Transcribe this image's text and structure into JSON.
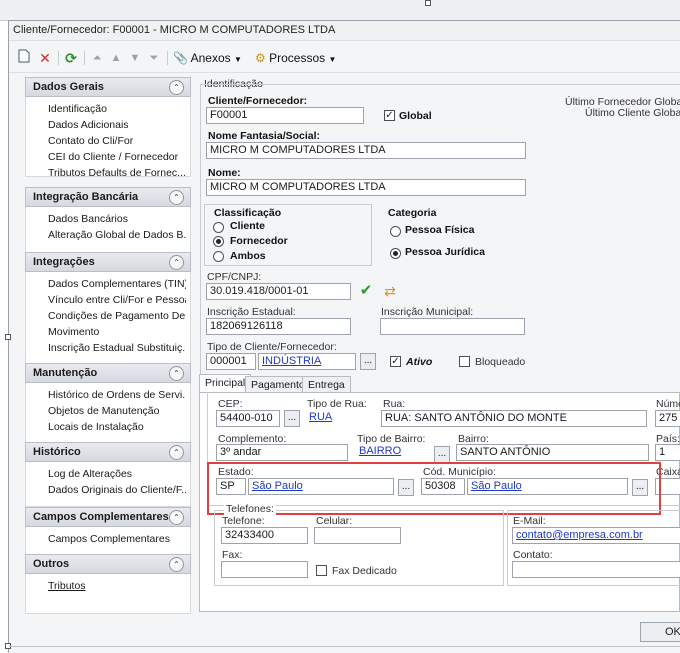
{
  "window": {
    "title": "Cliente/Fornecedor: F00001 - MICRO M COMPUTADORES LTDA",
    "ok_label": "OK"
  },
  "toolbar": {
    "anexos_label": "Anexos",
    "processos_label": "Processos"
  },
  "sidebar": {
    "sections": [
      {
        "title": "Dados Gerais",
        "items": [
          "Identificação",
          "Dados Adicionais",
          "Contato do Cli/For",
          "CEI do Cliente / Fornecedor",
          "Tributos Defaults de Fornec..."
        ]
      },
      {
        "title": "Integração Bancária",
        "items": [
          "Dados Bancários",
          "Alteração Global de Dados B..."
        ]
      },
      {
        "title": "Integrações",
        "items": [
          "Dados Complementares (TIN)",
          "Vínculo entre Cli/For e Pessoa",
          "Condições de Pagamento De...",
          "Movimento",
          "Inscrição Estadual Substituiç..."
        ]
      },
      {
        "title": "Manutenção",
        "items": [
          "Histórico de Ordens de Servi...",
          "Objetos de Manutenção",
          "Locais de Instalação"
        ]
      },
      {
        "title": "Histórico",
        "items": [
          "Log de Alterações",
          "Dados Originais do Cliente/F..."
        ]
      },
      {
        "title": "Campos Complementares",
        "items": [
          "Campos Complementares"
        ]
      },
      {
        "title": "Outros",
        "items": [
          "Tributos"
        ]
      }
    ]
  },
  "identificacao": {
    "group_label": "Identificação",
    "cliente_fornecedor_label": "Cliente/Fornecedor:",
    "cliente_fornecedor_value": "F00001",
    "global_label": "Global",
    "ultimo_fornecedor_label": "Último Fornecedor Global:",
    "ultimo_cliente_label": "Último Cliente Global:",
    "nome_fantasia_label": "Nome Fantasia/Social:",
    "nome_fantasia_value": "MICRO M COMPUTADORES LTDA",
    "nome_label": "Nome:",
    "nome_value": "MICRO M COMPUTADORES LTDA",
    "classificacao_label": "Classificação",
    "classificacao_options": [
      "Cliente",
      "Fornecedor",
      "Ambos"
    ],
    "classificacao_selected": "Fornecedor",
    "categoria_label": "Categoria",
    "categoria_options": [
      "Pessoa Física",
      "Pessoa Jurídica"
    ],
    "categoria_selected": "Pessoa Jurídica",
    "cpf_cnpj_label": "CPF/CNPJ:",
    "cpf_cnpj_value": "30.019.418/0001-01",
    "inscricao_estadual_label": "Inscrição Estadual:",
    "inscricao_estadual_value": "182069126118",
    "inscricao_municipal_label": "Inscrição Municipal:",
    "inscricao_municipal_value": "",
    "tipo_label": "Tipo de Cliente/Fornecedor:",
    "tipo_code": "000001",
    "tipo_name": "INDÚSTRIA",
    "ativo_label": "Ativo",
    "bloqueado_label": "Bloqueado"
  },
  "tabs": [
    "Principal",
    "Pagamento",
    "Entrega"
  ],
  "principal": {
    "cep_label": "CEP:",
    "cep_value": "54400-010",
    "tipo_rua_label": "Tipo de Rua:",
    "tipo_rua_value": "RUA",
    "rua_label": "Rua:",
    "rua_value": "RUA: SANTO ANTÔNIO DO MONTE",
    "numero_label": "Núme",
    "numero_value": "275",
    "complemento_label": "Complemento:",
    "complemento_value": "3º andar",
    "tipo_bairro_label": "Tipo de Bairro:",
    "tipo_bairro_value": "BAIRRO",
    "bairro_label": "Bairro:",
    "bairro_value": "SANTO ANTÔNIO",
    "pais_label": "País:",
    "pais_value": "1",
    "estado_label": "Estado:",
    "estado_code": "SP",
    "estado_name": "São Paulo",
    "cod_municipio_label": "Cód. Município:",
    "cod_municipio_code": "50308",
    "cod_municipio_name": "São Paulo",
    "caixa_label": "Caixa",
    "telefones_label": "Telefones:",
    "telefone_label": "Telefone:",
    "telefone_value": "32433400",
    "celular_label": "Celular:",
    "celular_value": "",
    "fax_label": "Fax:",
    "fax_value": "",
    "fax_dedicado_label": "Fax Dedicado",
    "email_label": "E-Mail:",
    "email_value": "contato@empresa.com.br",
    "contato_label": "Contato:",
    "contato_value": ""
  }
}
